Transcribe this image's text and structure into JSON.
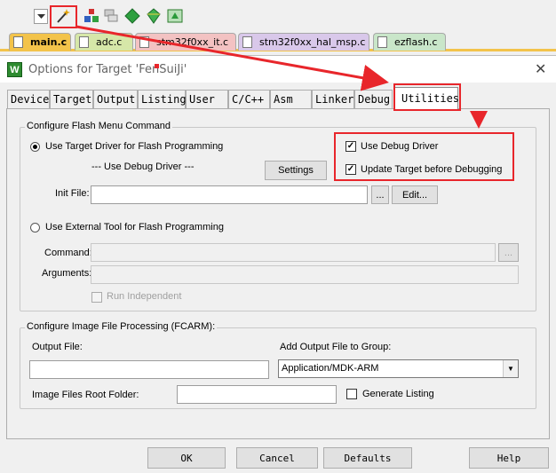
{
  "toolbar": {
    "icons": [
      "download-icon",
      "build-icon",
      "batch-icon",
      "debug-icon",
      "options-icon",
      "manage-icon",
      "layers-icon"
    ]
  },
  "file_tabs": [
    {
      "label": "main.c",
      "color": "#f3c34a",
      "active": true
    },
    {
      "label": "adc.c",
      "color": "#d6e7a8"
    },
    {
      "label": "stm32f0xx_it.c",
      "color": "#f3c2c2"
    },
    {
      "label": "stm32f0xx_hal_msp.c",
      "color": "#d9c8ea"
    },
    {
      "label": "ezflash.c",
      "color": "#c9e6c9"
    }
  ],
  "dialog": {
    "title": "Options for Target 'FenSuiJi'",
    "icon_letter": "W",
    "tabs": [
      "Device",
      "Target",
      "Output",
      "Listing",
      "User",
      "C/C++",
      "Asm",
      "Linker",
      "Debug",
      "Utilities"
    ],
    "active_tab": "Utilities",
    "flash_group": {
      "title": "Configure Flash Menu Command",
      "use_target_driver": "Use Target Driver for Flash Programming",
      "debug_driver_text": "--- Use Debug Driver ---",
      "settings_button": "Settings",
      "use_debug_driver": "Use Debug Driver",
      "update_target": "Update Target before Debugging",
      "init_file_label": "Init File:",
      "init_file_value": "",
      "browse_button": "...",
      "edit_button": "Edit...",
      "use_external_tool": "Use External Tool for Flash Programming",
      "command_label": "Command:",
      "arguments_label": "Arguments:",
      "run_independent": "Run Independent"
    },
    "image_group": {
      "title": "Configure Image File Processing (FCARM):",
      "output_file_label": "Output File:",
      "output_file_value": "",
      "add_output_label": "Add Output File  to Group:",
      "group_value": "Application/MDK-ARM",
      "root_folder_label": "Image Files Root Folder:",
      "root_folder_value": "",
      "generate_listing": "Generate Listing"
    },
    "buttons": {
      "ok": "OK",
      "cancel": "Cancel",
      "defaults": "Defaults",
      "help": "Help"
    }
  },
  "colors": {
    "annotation": "#e8262b",
    "tab_underline": "#f3c34a"
  }
}
